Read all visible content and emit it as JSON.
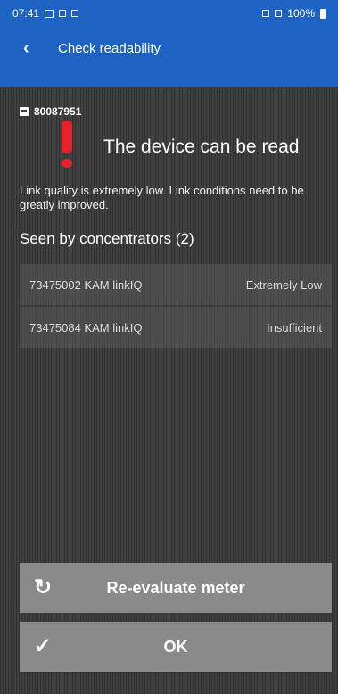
{
  "status_bar": {
    "time": "07:41",
    "right_text": "100%"
  },
  "header": {
    "title": "Check readability"
  },
  "meter": {
    "id": "80087951"
  },
  "alert": {
    "message": "The device can be read"
  },
  "description": "Link quality is extremely low. Link conditions need to be greatly improved.",
  "concentrators": {
    "title": "Seen by concentrators (2)",
    "items": [
      {
        "name": "73475002  KAM  linkIQ",
        "quality": "Extremely Low"
      },
      {
        "name": "73475084  KAM  linkIQ",
        "quality": "Insufficient"
      }
    ]
  },
  "buttons": {
    "reevaluate_label": "Re-evaluate meter",
    "ok_label": "OK"
  },
  "colors": {
    "primary": "#1e62c4",
    "alert": "#e8202a",
    "button": "#8a8a8a",
    "background": "#3a3a3a"
  }
}
